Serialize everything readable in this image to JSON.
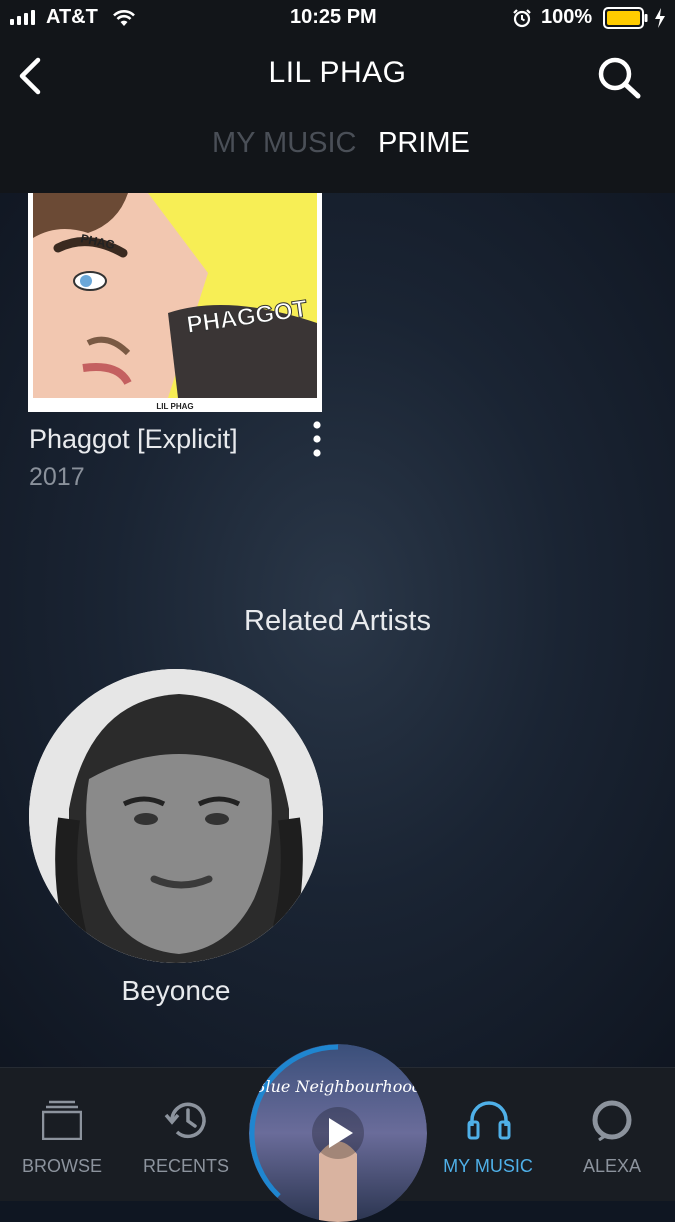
{
  "status": {
    "carrier": "AT&T",
    "time": "10:25 PM",
    "battery": "100%"
  },
  "header": {
    "title": "LIL PHAG"
  },
  "tabs": [
    {
      "label": "MY MUSIC"
    },
    {
      "label": "PRIME"
    }
  ],
  "album": {
    "title": "Phaggot [Explicit]",
    "year": "2017",
    "art_text": "PHAGGOT",
    "art_brow_text": "PHAG",
    "art_caption": "LIL PHAG"
  },
  "related": {
    "heading": "Related Artists",
    "artists": [
      {
        "name": "Beyonce"
      }
    ]
  },
  "now_playing": {
    "art_text": "Blue Neighbourhood"
  },
  "nav": [
    {
      "label": "BROWSE",
      "icon": "browse-icon"
    },
    {
      "label": "RECENTS",
      "icon": "recents-icon"
    },
    {
      "label": "MY MUSIC",
      "icon": "headphones-icon"
    },
    {
      "label": "ALEXA",
      "icon": "alexa-icon"
    }
  ],
  "colors": {
    "accent": "#4fb0e8",
    "battery": "#ffcc00",
    "album_bg": "#f7ee55"
  }
}
